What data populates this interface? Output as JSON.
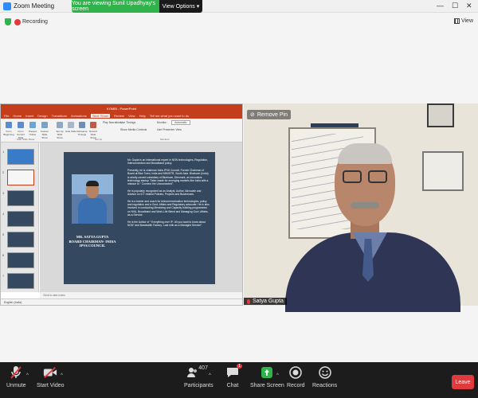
{
  "window": {
    "title": "Zoom Meeting",
    "minimize": "—",
    "maximize": "☐",
    "close": "✕"
  },
  "share_banner": {
    "message": "You are viewing Sunil Upadhyay's screen",
    "options_label": "View Options",
    "options_caret": "▾"
  },
  "status": {
    "recording_label": "Recording",
    "view_label": "View"
  },
  "colors": {
    "accent": "#2d8cff",
    "share_green": "#2fb34a",
    "record_red": "#e0393e",
    "ppt_orange": "#c43e1c",
    "toolbar_bg": "#1c1c1c"
  },
  "powerpoint": {
    "window_title": "KOMBI - PowerPoint",
    "menu": [
      "File",
      "Home",
      "Insert",
      "Design",
      "Transitions",
      "Animations",
      "Slide Show",
      "Review",
      "View",
      "Help"
    ],
    "tell_me": "Tell me what you want to do",
    "ribbon": {
      "buttons": [
        "From Beginning",
        "From Current Slide",
        "Present Online",
        "Custom Slide Show",
        "Set Up Slide Show",
        "Hide Slide",
        "Rehearse Timings",
        "Record Slide Show"
      ],
      "checks": [
        "Play Narrations",
        "Use Timings",
        "Show Media Controls"
      ],
      "monitor_label": "Monitor:",
      "monitor_value": "Automatic",
      "presenter_view": "Use Presenter View",
      "groups": [
        "Start Slide Show",
        "Set Up",
        "Monitors"
      ]
    },
    "thumbnails": [
      "1",
      "2",
      "3",
      "4",
      "5",
      "6",
      "7"
    ],
    "slide": {
      "name_line1": "MR. SATYA GUPTA",
      "name_line2": "BOARD CHAIRMAN- INDIA",
      "name_line3": "IPV6 COUNCIL",
      "paragraphs": [
        "Mr. Gupta is an international expert in NGN technologies, Regulation, Interconnection and Broadband policy.",
        "Presently, he is chairman India IPV6 Council, Former Chairman of Board at Blue Town, India and MINISTR, South Asia. Bluetown (India) is wholly-owned subsidiary of Bluetown, Denmark, an innovative technology startup ‘Tailor-made for emerging markets like India with a mission to “ Connect the Unconnected”.",
        "He is popularly recognized as an Analyst, Author, Advocate and Advisor on ICT related Policies, Projects and Businesses.",
        "He is a trainer and coach for telecommunication technologies, policy and regulation and a Govt. Affairs and Regulatory advocate. He is also involved in conducting Mentoring and Capacity building programmes on NVA, Broadband and Work-Life Blend and Managing Govt. Affairs- as-a-Service.",
        "He is the Author of “ Everything over IP- All you want to know about NGN” and Bandwidth Factory- Last mile as a Managed Service”."
      ]
    },
    "notes_placeholder": "Click to add notes",
    "status_text": "English (India)"
  },
  "video": {
    "remove_pin": "Remove Pin",
    "participant_name": "Satya Gupta"
  },
  "toolbar": {
    "unmute": "Unmute",
    "start_video": "Start Video",
    "participants": "Participants",
    "participants_count": "407",
    "chat": "Chat",
    "chat_badge": "1",
    "share_screen": "Share Screen",
    "record": "Record",
    "reactions": "Reactions",
    "leave": "Leave"
  }
}
